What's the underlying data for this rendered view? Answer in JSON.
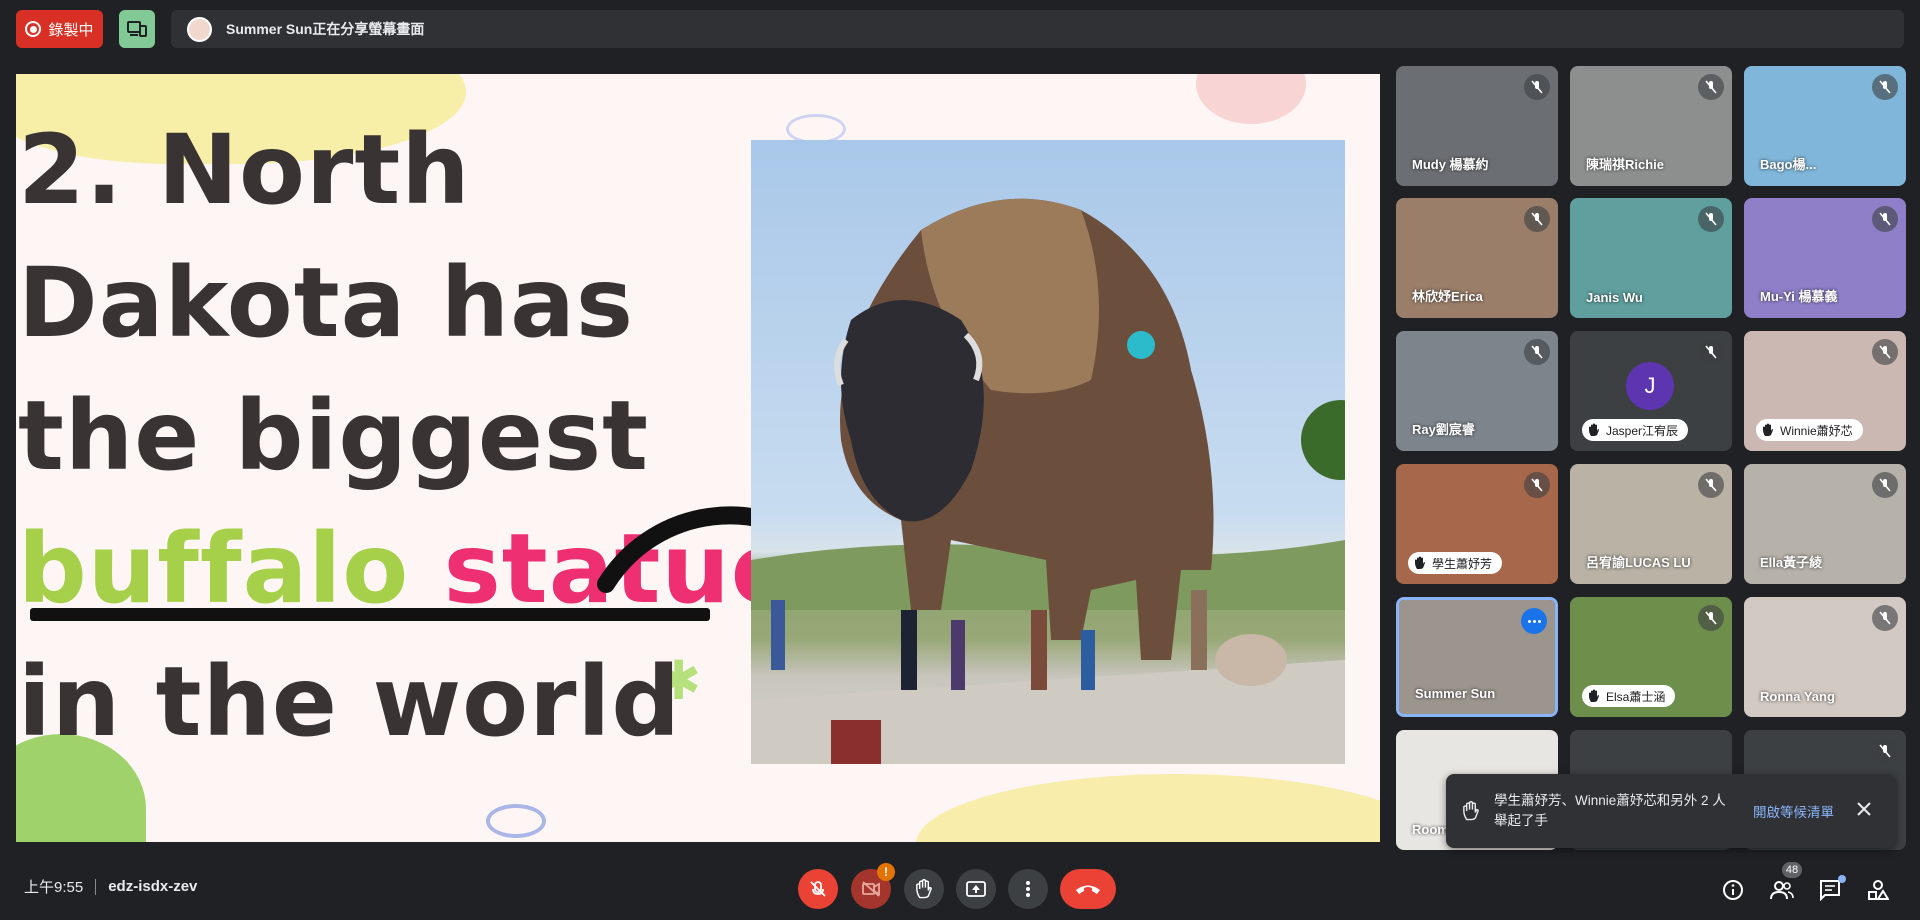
{
  "topbar": {
    "recording_label": "錄製中",
    "presenter_text": "Summer Sun正在分享螢幕畫面"
  },
  "slide": {
    "lines": [
      "2. North",
      "Dakota has",
      "the biggest",
      "in the world"
    ],
    "highlight_green": "buffalo",
    "highlight_pink": "statue"
  },
  "participants": [
    {
      "name": "Mudy 楊慕約",
      "bg": "#6b6f73"
    },
    {
      "name": "陳瑞祺Richie",
      "bg": "#8c8f8e"
    },
    {
      "name": "Bago楊...",
      "bg": "#7fb6d9"
    },
    {
      "name": "林欣妤Erica",
      "bg": "#9a7e6a"
    },
    {
      "name": "Janis Wu",
      "bg": "#5f9f9e"
    },
    {
      "name": "Mu-Yi 楊慕義",
      "bg": "#8f7fc9"
    },
    {
      "name": "Ray劉宸睿",
      "bg": "#7d848c"
    },
    {
      "name": "Jasper江宥辰",
      "bg": "#3c4043",
      "avatar": "J"
    },
    {
      "name": "Winnie蕭妤芯",
      "bg": "#cbb8b2"
    },
    {
      "name": "學生蕭妤芳",
      "bg": "#a7674a"
    },
    {
      "name": "呂宥諭LUCAS LU",
      "bg": "#b9b2a5"
    },
    {
      "name": "Ella黃子綾",
      "bg": "#b6b2aa"
    },
    {
      "name": "Summer Sun",
      "bg": "#9c958e"
    },
    {
      "name": "Elsa蕭士涵",
      "bg": "#6e8f4c"
    },
    {
      "name": "Ronna Yang",
      "bg": "#d2c9c3"
    },
    {
      "name": "Room...",
      "bg": "#e8e6e2"
    },
    {
      "name": "",
      "bg": "#3c4043"
    },
    {
      "name": "",
      "bg": "#3c4043"
    }
  ],
  "notification": {
    "text": "學生蕭妤芳、Winnie蕭妤芯和另外 2 人舉起了手",
    "link": "開啟等候清單"
  },
  "bottombar": {
    "time": "上午9:55",
    "meeting_code": "edz-isdx-zev",
    "camera_badge": "!",
    "participant_count": "48"
  },
  "colors": {
    "accent_blue": "#8ab4f8",
    "danger_red": "#ea4335",
    "recording_red": "#d93025"
  }
}
